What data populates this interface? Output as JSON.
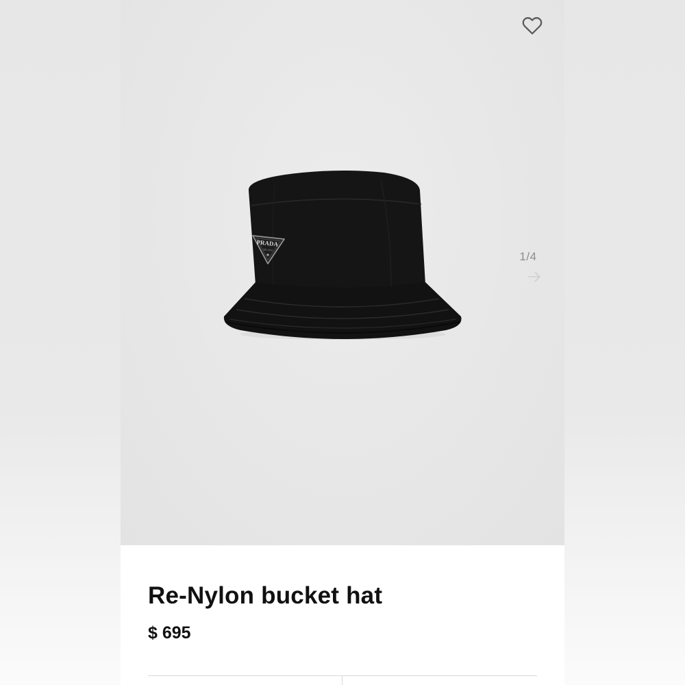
{
  "gallery": {
    "counter": "1/4",
    "wishlist_icon": "heart-outline-icon",
    "next_icon": "arrow-right-icon",
    "logo_text": "PRADA",
    "logo_subtext": "MILANO"
  },
  "product": {
    "name": "Re-Nylon bucket hat",
    "price": "$ 695"
  },
  "colors": {
    "gallery_bg": "#e7e7e7",
    "text": "#111111",
    "muted": "#8c8c8c"
  }
}
